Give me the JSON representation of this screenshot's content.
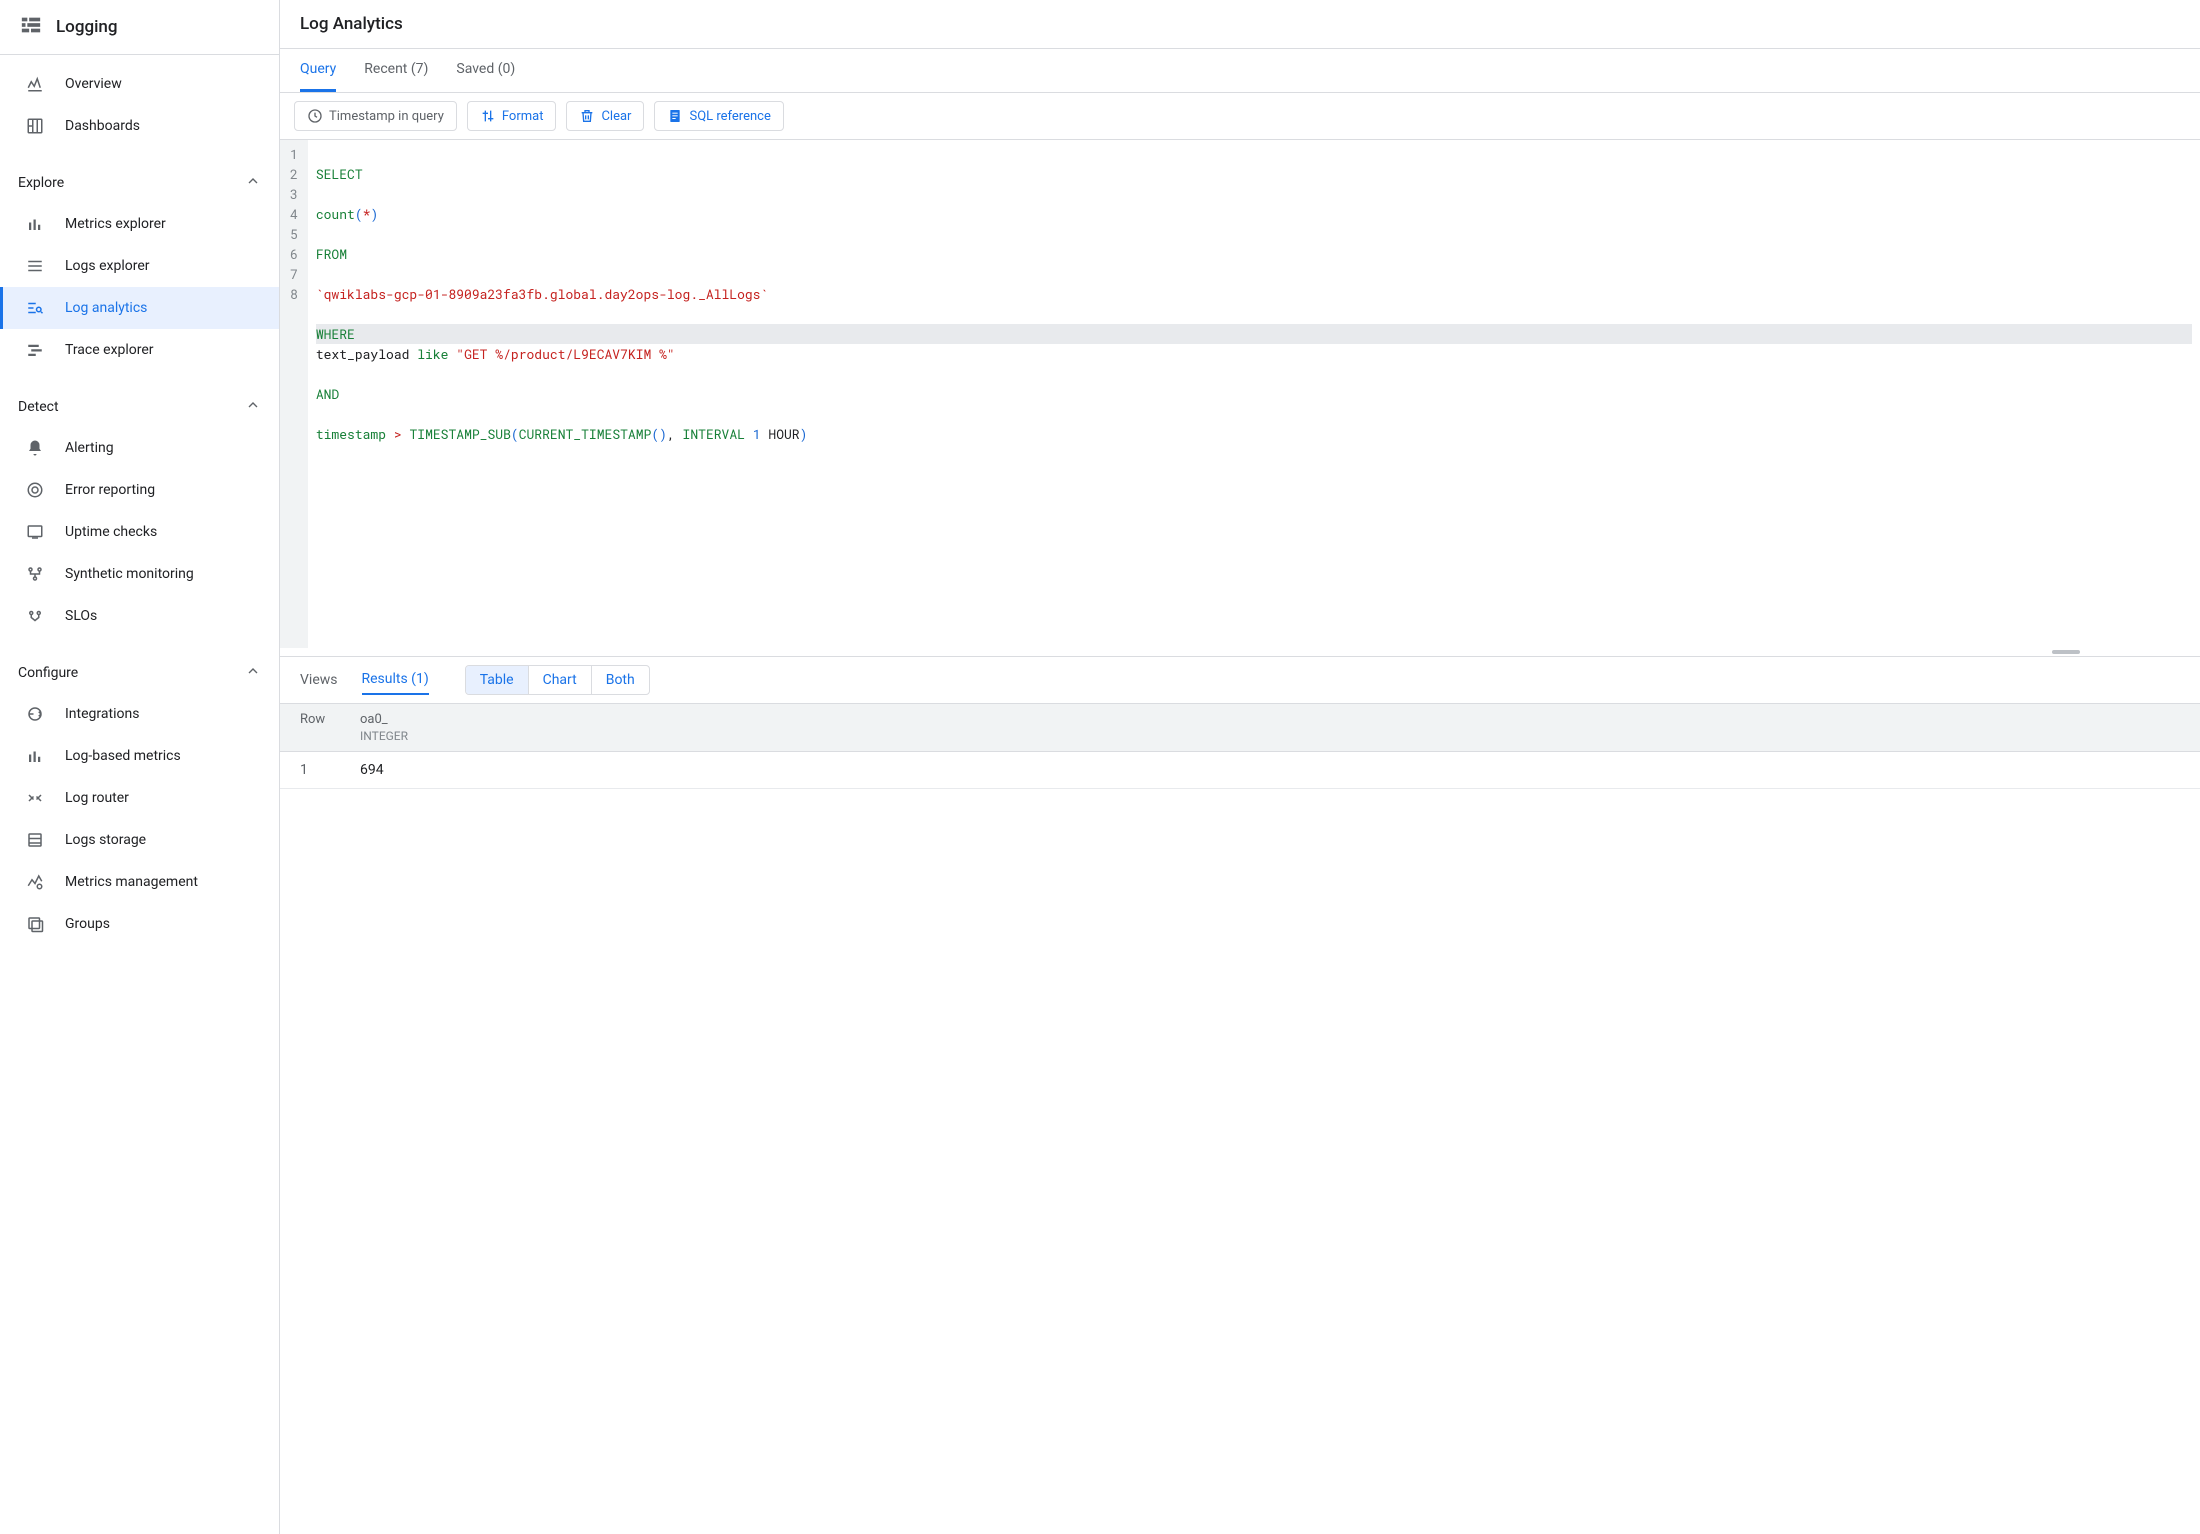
{
  "sidebar": {
    "title": "Logging",
    "top_items": [
      {
        "label": "Overview",
        "icon": "overview"
      },
      {
        "label": "Dashboards",
        "icon": "dashboards"
      }
    ],
    "groups": [
      {
        "label": "Explore",
        "items": [
          {
            "label": "Metrics explorer",
            "icon": "bars"
          },
          {
            "label": "Logs explorer",
            "icon": "lines"
          },
          {
            "label": "Log analytics",
            "icon": "search-lines",
            "active": true
          },
          {
            "label": "Trace explorer",
            "icon": "trace"
          }
        ]
      },
      {
        "label": "Detect",
        "items": [
          {
            "label": "Alerting",
            "icon": "bell"
          },
          {
            "label": "Error reporting",
            "icon": "error"
          },
          {
            "label": "Uptime checks",
            "icon": "uptime"
          },
          {
            "label": "Synthetic monitoring",
            "icon": "synthetic"
          },
          {
            "label": "SLOs",
            "icon": "slos"
          }
        ]
      },
      {
        "label": "Configure",
        "items": [
          {
            "label": "Integrations",
            "icon": "integrations"
          },
          {
            "label": "Log-based metrics",
            "icon": "bars"
          },
          {
            "label": "Log router",
            "icon": "router"
          },
          {
            "label": "Logs storage",
            "icon": "storage"
          },
          {
            "label": "Metrics management",
            "icon": "metrics-mgmt"
          },
          {
            "label": "Groups",
            "icon": "groups"
          }
        ]
      }
    ]
  },
  "page": {
    "title": "Log Analytics"
  },
  "query_tabs": {
    "query": "Query",
    "recent": "Recent (7)",
    "saved": "Saved (0)"
  },
  "toolbar": {
    "timestamp": "Timestamp in query",
    "format": "Format",
    "clear": "Clear",
    "sql_ref": "SQL reference"
  },
  "code_lines": [
    "1",
    "2",
    "3",
    "4",
    "5",
    "6",
    "7",
    "8"
  ],
  "code": {
    "select": "SELECT",
    "count": "count",
    "from": "FROM",
    "table": "`qwiklabs-gcp-01-8909a23fa3fb.global.day2ops-log._AllLogs`",
    "where": "WHERE",
    "field1": "text_payload",
    "like": "like",
    "str1": "\"GET %/product/L9ECAV7KIM %\"",
    "and": "AND",
    "ts": "timestamp",
    "gt": ">",
    "ts_sub": "TIMESTAMP_SUB",
    "cur_ts": "CURRENT_TIMESTAMP",
    "interval": "INTERVAL",
    "one": "1",
    "hour": "HOUR"
  },
  "results": {
    "views_label": "Views",
    "results_label": "Results (1)",
    "view_modes": {
      "table": "Table",
      "chart": "Chart",
      "both": "Both"
    },
    "header_row": "Row",
    "columns": [
      {
        "name": "oa0_",
        "type": "INTEGER"
      }
    ],
    "rows": [
      {
        "n": "1",
        "values": [
          "694"
        ]
      }
    ]
  }
}
